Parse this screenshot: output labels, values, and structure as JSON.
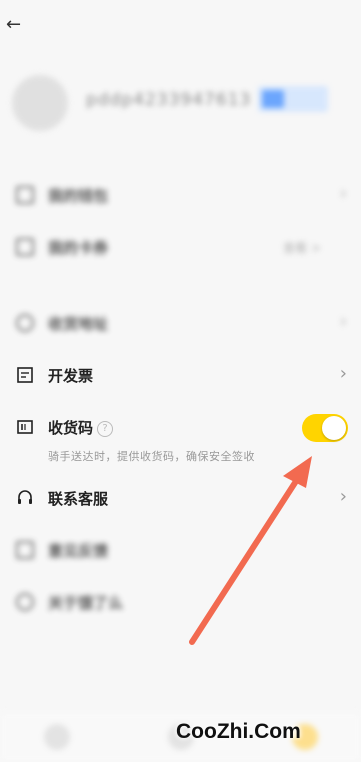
{
  "header": {
    "back_icon": "arrow-left-icon"
  },
  "profile": {
    "username": "pddp4233947613"
  },
  "blurred_rows": [
    {
      "label": "我的钱包",
      "icon": "wallet-icon"
    },
    {
      "label": "我的卡券",
      "icon": "card-icon",
      "value": "查看 >"
    },
    {
      "label": "收货地址",
      "icon": "location-icon"
    }
  ],
  "menu": {
    "invoice": {
      "label": "开发票",
      "icon": "invoice-icon"
    },
    "delivery_code": {
      "label": "收货码",
      "description": "骑手送达时，提供收货码，确保安全签收",
      "toggle_on": true,
      "toggle_color": "#ffd400"
    },
    "customer_service": {
      "label": "联系客服",
      "icon": "headset-icon"
    }
  },
  "blurred_rows_bottom": [
    {
      "label": "意见反馈"
    },
    {
      "label": "关于饿了么"
    }
  ],
  "arrow_color": "#f26a50",
  "watermark": "CooZhi.Com"
}
